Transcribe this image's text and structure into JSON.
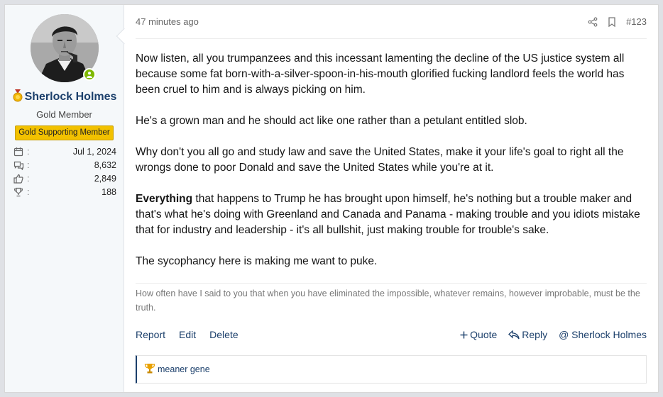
{
  "user": {
    "name": "Sherlock Holmes",
    "title": "Gold Member",
    "banner": "Gold Supporting Member",
    "stats": [
      {
        "icon": "calendar-icon",
        "value": "Jul 1, 2024"
      },
      {
        "icon": "messages-icon",
        "value": "8,632"
      },
      {
        "icon": "thumbs-up-icon",
        "value": "2,849"
      },
      {
        "icon": "trophy-icon",
        "value": "188"
      }
    ],
    "colon": ":"
  },
  "post": {
    "time": "47 minutes ago",
    "number": "#123",
    "paragraphs": [
      "Now listen, all you trumpanzees and this incessant lamenting the decline of the US justice system all because some fat born-with-a-silver-spoon-in-his-mouth glorified fucking landlord feels the world has been cruel to him and is always picking on him.",
      "He's a grown man and he should act like one rather than a petulant entitled slob.",
      "Why don't you all go and study law and save the United States, make it your life's goal to right all the wrongs done to poor Donald and save the United States while you're at it."
    ],
    "bold_word": "Everything",
    "paragraph4_rest": " that happens to Trump he has brought upon himself, he's nothing but a trouble maker and that's what he's doing with Greenland and Canada and Panama - making trouble and you idiots mistake that for industry and leadership - it's all bullshit, just making trouble for trouble's sake.",
    "paragraph5": "The sycophancy here is making me want to puke.",
    "signature": "How often have I said to you that when you have eliminated the impossible, whatever remains, however improbable, must be the truth."
  },
  "footer": {
    "report": "Report",
    "edit": "Edit",
    "delete": "Delete",
    "quote": "Quote",
    "reply": "Reply",
    "mention": "@ Sherlock Holmes"
  },
  "reactions": {
    "text": "meaner gene"
  },
  "colors": {
    "link": "#1b3f6b",
    "banner": "#f2c100",
    "online": "#7fb900"
  }
}
